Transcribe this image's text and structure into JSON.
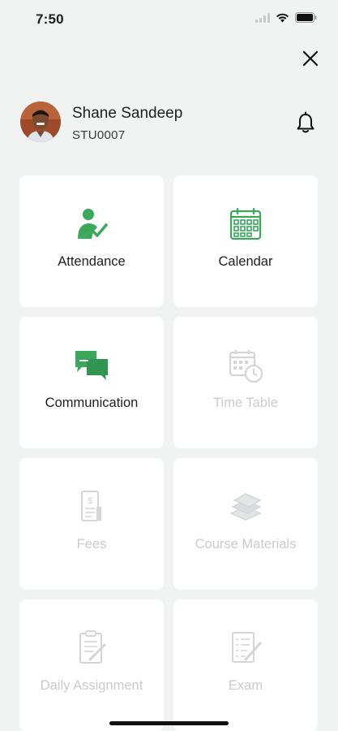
{
  "status_bar": {
    "time": "7:50"
  },
  "profile": {
    "name": "Shane Sandeep",
    "student_id": "STU0007"
  },
  "colors": {
    "accent": "#3aa75b",
    "disabled": "#c9cbcd",
    "background": "#f1f2f2",
    "tile": "#ffffff"
  },
  "menu": [
    {
      "label": "Attendance",
      "icon": "attendance-icon",
      "enabled": true
    },
    {
      "label": "Calendar",
      "icon": "calendar-icon",
      "enabled": true
    },
    {
      "label": "Communication",
      "icon": "chat-icon",
      "enabled": true
    },
    {
      "label": "Time Table",
      "icon": "timetable-icon",
      "enabled": false
    },
    {
      "label": "Fees",
      "icon": "fees-receipt-icon",
      "enabled": false
    },
    {
      "label": "Course Materials",
      "icon": "books-icon",
      "enabled": false
    },
    {
      "label": "Daily Assignment",
      "icon": "assignment-icon",
      "enabled": false
    },
    {
      "label": "Exam",
      "icon": "exam-icon",
      "enabled": false
    }
  ]
}
